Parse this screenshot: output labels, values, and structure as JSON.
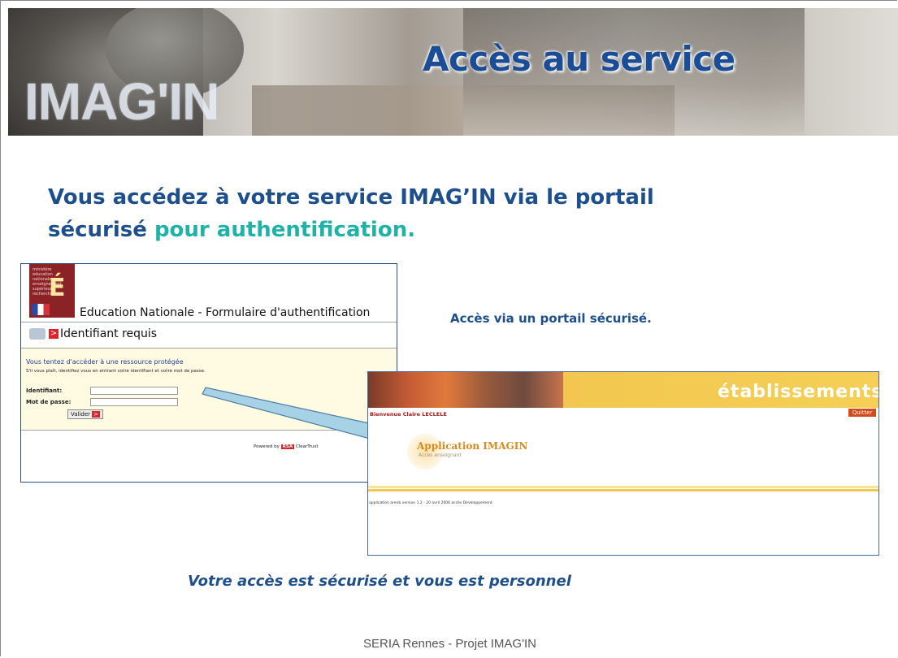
{
  "banner": {
    "logo_text": "IMAG'IN",
    "title": "Accès au service"
  },
  "heading": {
    "line1": "Vous accédez à votre service IMAG’IN via le portail",
    "line2_start": "sécurisé ",
    "line2_accent": "pour authentification."
  },
  "auth_window": {
    "ministry_lines": "ministère éducation nationale enseignement supérieur recherche",
    "ministry_letter": "É",
    "title": "Education Nationale - Formulaire d'authentification",
    "section_title": "Identifiant requis",
    "warning": "Vous tentez d'accéder à une ressource protégée",
    "info": "S'il vous plaît, identifiez vous en entrant votre identifiant et votre mot de passe.",
    "fields": {
      "identifiant_label": "Identifiant:",
      "password_label": "Mot de passe:"
    },
    "submit_label": "Valider",
    "submit_arrow": ">",
    "powered_prefix": "Powered by",
    "powered_rsa": "RSA",
    "powered_suffix": "ClearTrust"
  },
  "side_label": "Accès via un portail sécurisé.",
  "app_window": {
    "brand": "établissements",
    "welcome": "Bienvenue Claire LECLELE",
    "quit_label": "Quitter",
    "app_name": "Application IMAGIN",
    "app_sub": "Acces enseignant",
    "version_text": "application arenb version 1.2 - 20 avril 2006 accès Developpement"
  },
  "caption": "Votre accès est sécurisé et vous est personnel",
  "footer": "SERIA Rennes - Projet IMAG'IN",
  "colors": {
    "title_blue": "#1b4c96",
    "accent_teal": "#1fb3a8",
    "rsa_red": "#d9262c"
  }
}
